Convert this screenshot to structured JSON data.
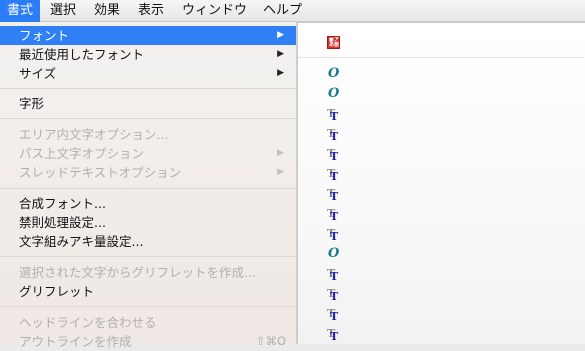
{
  "menubar": {
    "items": [
      "書式",
      "選択",
      "効果",
      "表示",
      "ウィンドウ",
      "ヘルプ"
    ]
  },
  "menu": {
    "items": [
      {
        "label": "フォント",
        "submenu": true,
        "highlighted": true
      },
      {
        "label": "最近使用したフォント",
        "submenu": true
      },
      {
        "label": "サイズ",
        "submenu": true
      },
      {
        "label": "字形"
      },
      {
        "label": "エリア内文字オプション...",
        "disabled": true
      },
      {
        "label": "パス上文字オプション",
        "submenu": true,
        "disabled": true
      },
      {
        "label": "スレッドテキストオプション",
        "submenu": true,
        "disabled": true
      },
      {
        "label": "合成フォント..."
      },
      {
        "label": "禁則処理設定..."
      },
      {
        "label": "文字組みアキ量設定..."
      },
      {
        "label": "選択された文字からグリフレットを作成...",
        "disabled": true
      },
      {
        "label": "グリフレット"
      },
      {
        "label": "ヘッドラインを合わせる",
        "disabled": true
      },
      {
        "label": "アウトラインを作成",
        "disabled": true,
        "shortcut": "⇧⌘O"
      }
    ],
    "arrow_glyph": "▶"
  },
  "submenu": {
    "icons": [
      "japanese-font-icon",
      "opentype-font-icon",
      "opentype-font-icon",
      "truetype-font-icon",
      "truetype-font-icon",
      "truetype-font-icon",
      "truetype-font-icon",
      "truetype-font-icon",
      "truetype-font-icon",
      "truetype-font-icon",
      "opentype-font-icon",
      "truetype-font-icon",
      "truetype-font-icon",
      "truetype-font-icon",
      "truetype-font-icon"
    ]
  },
  "colors": {
    "accent": "#2b7df7",
    "disabled_text": "#b3afac"
  }
}
